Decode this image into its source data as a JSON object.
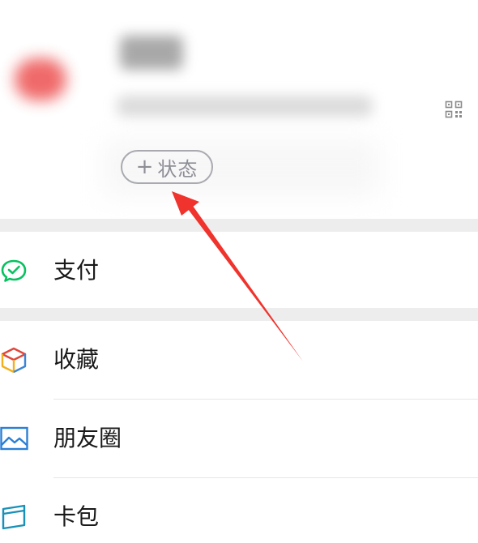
{
  "profile": {
    "status_button": {
      "plus": "+",
      "label": "状态"
    }
  },
  "menu": {
    "items": [
      {
        "id": "pay",
        "label": "支付",
        "icon": "wechat-pay-icon",
        "color": "#07c160"
      },
      {
        "id": "favorites",
        "label": "收藏",
        "icon": "favorites-cube-icon"
      },
      {
        "id": "moments",
        "label": "朋友圈",
        "icon": "moments-picture-icon",
        "color": "#2b7fd6"
      },
      {
        "id": "cards",
        "label": "卡包",
        "icon": "card-wallet-icon",
        "color": "#1890b8"
      }
    ]
  },
  "annotation": {
    "arrow_color": "#f0332c"
  }
}
